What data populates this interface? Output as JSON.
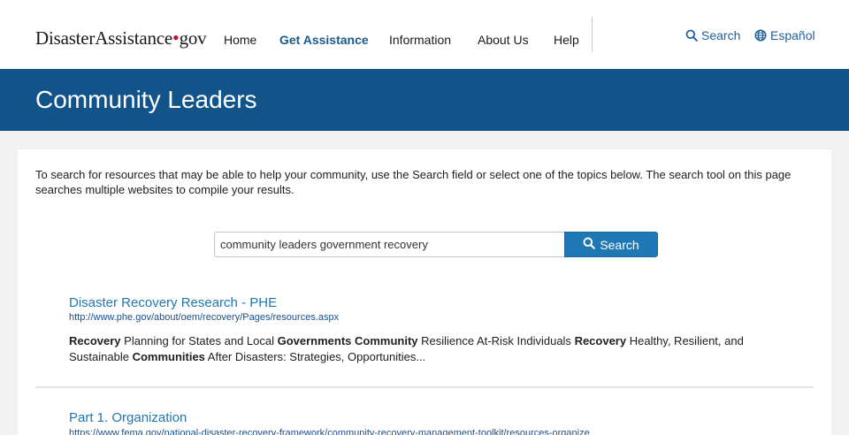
{
  "header": {
    "logo": {
      "part1": "Disaster",
      "part2": "Assistance",
      "dot": "•",
      "part3": "gov"
    },
    "nav": [
      {
        "label": "Home",
        "active": false
      },
      {
        "label": "Get Assistance",
        "active": true
      },
      {
        "label": "Information",
        "active": false
      },
      {
        "label": "About Us",
        "active": false
      },
      {
        "label": "Help",
        "active": false
      }
    ],
    "utility": {
      "search_label": "Search",
      "spanish_label": "Español"
    }
  },
  "banner": {
    "title": "Community Leaders"
  },
  "content": {
    "intro": "To search for resources that may be able to help your community, use the Search field or select one of the topics below. The search tool on this page searches multiple websites to compile your results.",
    "search": {
      "value": "community leaders government recovery",
      "button_label": "Search"
    },
    "results": [
      {
        "title": "Disaster Recovery Research - PHE",
        "url": "http://www.phe.gov/about/oem/recovery/Pages/resources.aspx",
        "snippet_parts": [
          {
            "text": "Recovery",
            "bold": true
          },
          {
            "text": " Planning for States and Local ",
            "bold": false
          },
          {
            "text": "Governments Community",
            "bold": true
          },
          {
            "text": " Resilience At-Risk Individuals ",
            "bold": false
          },
          {
            "text": "Recovery",
            "bold": true
          },
          {
            "text": " Healthy, Resilient, and Sustainable ",
            "bold": false
          },
          {
            "text": "Communities",
            "bold": true
          },
          {
            "text": " After Disasters: Strategies, Opportunities...",
            "bold": false
          }
        ]
      },
      {
        "title": "Part 1. Organization",
        "url": "https://www.fema.gov/national-disaster-recovery-framework/community-recovery-management-toolkit/resources-organize"
      }
    ]
  },
  "colors": {
    "banner": "#12548a",
    "link": "#1f77b4",
    "button": "#1f77b4",
    "logo_dot": "#c0102a"
  }
}
